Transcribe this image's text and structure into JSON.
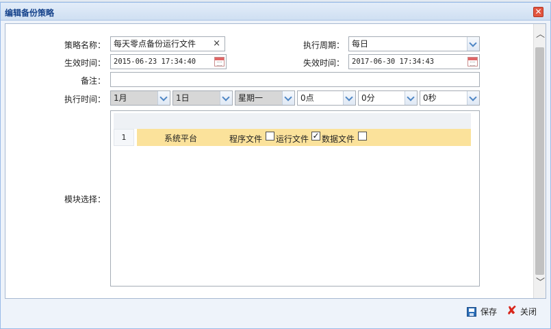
{
  "window": {
    "title": "编辑备份策略"
  },
  "form": {
    "policy_name_label": "策略名称：",
    "policy_name_value": "每天零点备份运行文件",
    "period_label": "执行周期：",
    "period_value": "每日",
    "start_label": "生效时间：",
    "start_value": "2015-06-23 17:34:40",
    "end_label": "失效时间：",
    "end_value": "2017-06-30 17:34:43",
    "remark_label": "备注：",
    "remark_value": "",
    "exec_time_label": "执行时间：",
    "exec_time": {
      "month": "1月",
      "day": "1日",
      "weekday": "星期一",
      "hour": "0点",
      "minute": "0分",
      "second": "0秒"
    },
    "module_label": "模块选择："
  },
  "modules": {
    "rows": [
      {
        "num": "1",
        "name": "系统平台",
        "options": [
          {
            "label": "程序文件",
            "checked": false
          },
          {
            "label": "运行文件",
            "checked": true
          },
          {
            "label": "数据文件",
            "checked": false
          }
        ]
      }
    ]
  },
  "footer": {
    "save_label": "保存",
    "close_label": "关闭"
  },
  "colors": {
    "row_highlight": "#fbe29b",
    "title_text": "#15428b",
    "close_red": "#d8261b"
  }
}
